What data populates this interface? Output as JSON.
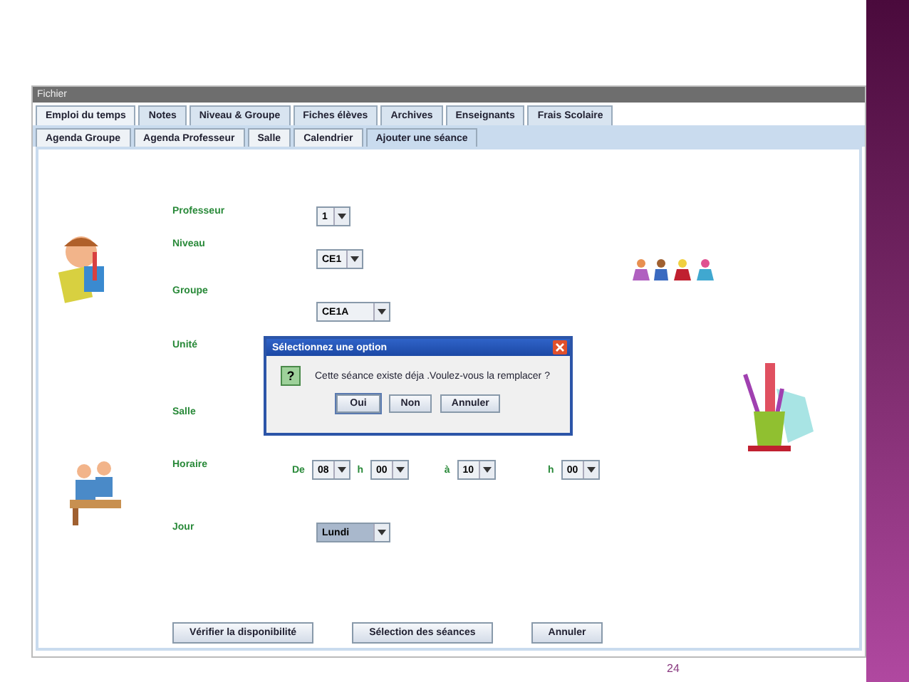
{
  "menu": [
    "Fichier"
  ],
  "tabs": [
    {
      "label": "Emploi du temps",
      "selected": true
    },
    {
      "label": "Notes",
      "selected": false
    },
    {
      "label": "Niveau & Groupe",
      "selected": false
    },
    {
      "label": "Fiches élèves",
      "selected": false
    },
    {
      "label": "Archives",
      "selected": false
    },
    {
      "label": "Enseignants",
      "selected": false
    },
    {
      "label": "Frais Scolaire",
      "selected": false
    }
  ],
  "subtabs": [
    {
      "label": "Agenda Groupe",
      "selected": false
    },
    {
      "label": "Agenda Professeur",
      "selected": false
    },
    {
      "label": "Salle",
      "selected": false
    },
    {
      "label": "Calendrier",
      "selected": false
    },
    {
      "label": "Ajouter une séance",
      "selected": true
    }
  ],
  "rows": [
    {
      "kind": "combo",
      "label": "Professeur",
      "value": "1",
      "focused": false
    },
    {
      "kind": "combo",
      "label": "Niveau",
      "value": "CE1",
      "focused": false
    },
    {
      "kind": "combo",
      "label": "Groupe",
      "value": "CE1A",
      "focused": false
    },
    {
      "kind": "label",
      "label": "Unité"
    },
    {
      "kind": "label",
      "label": "Salle"
    },
    {
      "kind": "time",
      "label": "Horaire",
      "from_word": "De",
      "from_hour": "08",
      "from_h": "h",
      "from_min": "00",
      "to_word": "à",
      "to_hour": "10",
      "to_h": "h",
      "to_min": "00"
    },
    {
      "kind": "combo",
      "label": "Jour",
      "value": "Lundi",
      "focused": true
    }
  ],
  "buttons": [
    "Vérifier la disponibilité",
    "Sélection des séances",
    "Annuler"
  ],
  "dialog": {
    "title": "Sélectionnez une option",
    "icon": "?",
    "message": "Cette séance existe déja .Voulez-vous la remplacer ?",
    "buttons": [
      {
        "label": "Oui",
        "focused": true
      },
      {
        "label": "Non",
        "focused": false
      },
      {
        "label": "Annuler",
        "focused": false
      }
    ]
  },
  "page_number": "24"
}
